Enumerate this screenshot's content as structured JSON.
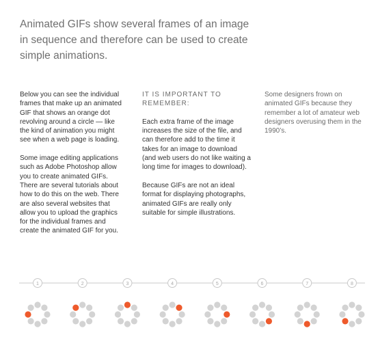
{
  "intro": "Animated GIFs show several frames of an image in sequence and therefore can be used to create simple animations.",
  "column1": {
    "paragraphs": [
      "Below you can see the individual frames that make up an animated GIF that shows an orange dot revolving around a circle — like the kind of animation you might see when a web page is loading.",
      "Some image editing applications such as Adobe Photoshop allow you to create animated GIFs. There are several tutorials about how to do this on the web. There are also several websites that allow you to upload the graphics for the individual frames and create the animated GIF for you."
    ]
  },
  "column2": {
    "heading": "IT IS IMPORTANT TO REMEMBER:",
    "paragraphs": [
      "Each extra frame of the image increases the size of the file, and can therefore add to the time it takes for an image to download (and web users do not like waiting a long time for images to download).",
      "Because GIFs are not an ideal format for displaying photographs, animated GIFs are really only suitable for simple illustrations."
    ]
  },
  "column3": {
    "paragraphs": [
      "Some designers frown on animated GIFs because they remember a lot of amateur web designers overusing them in the 1990’s."
    ]
  },
  "frames": {
    "labels": [
      "1",
      "2",
      "3",
      "4",
      "5",
      "6",
      "7",
      "8"
    ],
    "active_dot_index": [
      7,
      0,
      1,
      2,
      3,
      4,
      5,
      6
    ],
    "colors": {
      "active": "#ee5a2c",
      "inactive": "#d3d3d3",
      "line": "#c8c8c8",
      "marker_text": "#a8a8a8"
    }
  }
}
